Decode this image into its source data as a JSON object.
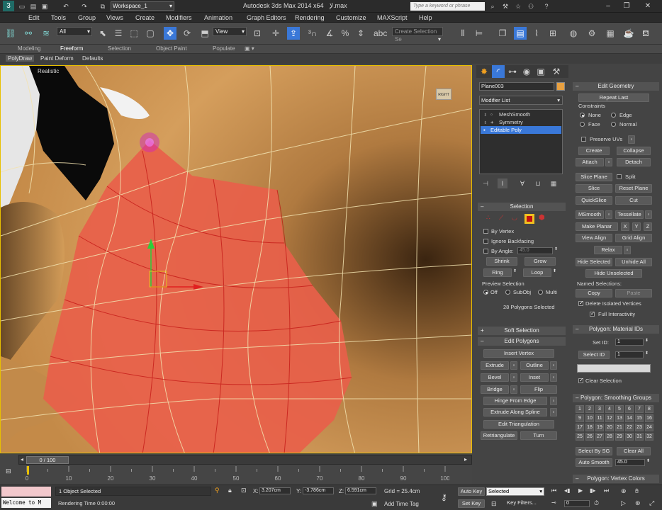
{
  "title": {
    "workspace": "Workspace_1",
    "app_title": "Autodesk 3ds Max  2014 x64",
    "file": "لإ.max",
    "search_placeholder": "Type a keyword or phrase",
    "menus": [
      "Edit",
      "Tools",
      "Group",
      "Views",
      "Create",
      "Modifiers",
      "Animation",
      "Graph Editors",
      "Rendering",
      "Customize",
      "MAXScript",
      "Help"
    ]
  },
  "toolbar": {
    "filter": "All",
    "ref_coord": "View",
    "selection_set": "Create Selection Se"
  },
  "ribbon": {
    "tabs": [
      "Modeling",
      "Freeform",
      "Selection",
      "Object Paint",
      "Populate"
    ],
    "subtabs": [
      "PolyDraw",
      "Paint Deform",
      "Defaults"
    ]
  },
  "viewport": {
    "label": "[ + ] [ Right ] [ Realistic ]",
    "label_visible": "Realistic",
    "viewcube": "RIGHT"
  },
  "command_panel": {
    "object_name": "Plane003",
    "modifier_list": "Modifier List",
    "stack": [
      "MeshSmooth",
      "Symmetry",
      "Editable Poly"
    ],
    "selection": {
      "title": "Selection",
      "by_vertex": "By Vertex",
      "ignore_backfacing": "Ignore Backfacing",
      "by_angle": "By Angle:",
      "angle_value": "45.0",
      "shrink": "Shrink",
      "grow": "Grow",
      "ring": "Ring",
      "loop": "Loop",
      "preview_selection": "Preview Selection",
      "preview_off": "Off",
      "preview_subobj": "SubObj",
      "preview_multi": "Multi",
      "status": "28 Polygons Selected"
    },
    "soft_selection": "Soft Selection",
    "edit_polygons": {
      "title": "Edit Polygons",
      "insert_vertex": "Insert Vertex",
      "extrude": "Extrude",
      "outline": "Outline",
      "bevel": "Bevel",
      "inset": "Inset",
      "bridge": "Bridge",
      "flip": "Flip",
      "hinge_from_edge": "Hinge From Edge",
      "extrude_along_spline": "Extrude Along Spline",
      "edit_triangulation": "Edit Triangulation",
      "retriangulate": "Retriangulate",
      "turn": "Turn"
    }
  },
  "edit_geometry": {
    "title": "Edit Geometry",
    "repeat_last": "Repeat Last",
    "constraints": "Constraints",
    "c_none": "None",
    "c_edge": "Edge",
    "c_face": "Face",
    "c_normal": "Normal",
    "preserve_uvs": "Preserve UVs",
    "create": "Create",
    "collapse": "Collapse",
    "attach": "Attach",
    "detach": "Detach",
    "slice_plane": "Slice Plane",
    "split": "Split",
    "slice": "Slice",
    "reset_plane": "Reset Plane",
    "quickslice": "QuickSlice",
    "cut": "Cut",
    "msmooth": "MSmooth",
    "tessellate": "Tessellate",
    "make_planar": "Make Planar",
    "x": "X",
    "y": "Y",
    "z": "Z",
    "view_align": "View Align",
    "grid_align": "Grid Align",
    "relax": "Relax",
    "hide_selected": "Hide Selected",
    "unhide_all": "Unhide All",
    "hide_unselected": "Hide Unselected",
    "named_selections": "Named Selections:",
    "copy": "Copy",
    "paste": "Paste",
    "delete_isolated": "Delete Isolated Vertices",
    "full_interactivity": "Full Interactivity"
  },
  "material_ids": {
    "title": "Polygon: Material IDs",
    "set_id": "Set ID:",
    "set_id_value": "1",
    "select_id": "Select ID",
    "select_id_value": "1",
    "clear_selection": "Clear Selection"
  },
  "smoothing_groups": {
    "title": "Polygon: Smoothing Groups",
    "groups": [
      "1",
      "2",
      "3",
      "4",
      "5",
      "6",
      "7",
      "8",
      "9",
      "10",
      "11",
      "12",
      "13",
      "14",
      "15",
      "16",
      "17",
      "18",
      "19",
      "20",
      "21",
      "22",
      "23",
      "24",
      "25",
      "26",
      "27",
      "28",
      "29",
      "30",
      "31",
      "32"
    ],
    "select_by_sg": "Select By SG",
    "clear_all": "Clear All",
    "auto_smooth": "Auto Smooth",
    "auto_smooth_value": "45.0",
    "vertex_colors": "Polygon: Vertex Colors"
  },
  "timeline": {
    "frame_counter": "0 / 100",
    "ticks": [
      "0",
      "10",
      "20",
      "30",
      "40",
      "50",
      "60",
      "70",
      "80",
      "90",
      "100"
    ]
  },
  "status": {
    "maxscript": "Welcome to M",
    "objects_selected": "1 Object Selected",
    "rendering_time": "Rendering Time  0:00:00",
    "x_label": "X:",
    "x_value": "3.207cm",
    "y_label": "Y:",
    "y_value": "-3.786cm",
    "z_label": "Z:",
    "z_value": "6.591cm",
    "grid": "Grid = 25.4cm",
    "add_time_tag": "Add Time Tag",
    "auto_key": "Auto Key",
    "selected": "Selected",
    "set_key": "Set Key",
    "key_filters": "Key Filters...",
    "frame": "0"
  },
  "colors": {
    "skin": "#d19a5a",
    "selected_poly": "#e8604a",
    "wire": "#f3e3b0",
    "selection_red": "#c01010",
    "stack_highlight": "#3a78d8"
  }
}
